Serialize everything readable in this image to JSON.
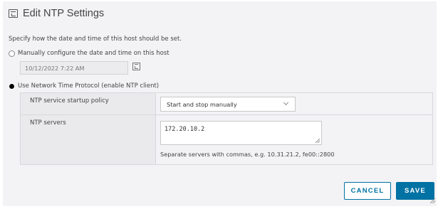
{
  "dialog": {
    "title": "Edit NTP Settings",
    "description": "Specify how the date and time of this host should be set."
  },
  "options": {
    "manual_label": "Manually configure the date and time on this host",
    "manual_datetime": "10/12/2022 7:22 AM",
    "ntp_label": "Use Network Time Protocol (enable NTP client)",
    "selected": "ntp"
  },
  "ntp": {
    "policy_label": "NTP service startup policy",
    "policy_value": "Start and stop manually",
    "servers_label": "NTP servers",
    "servers_value": "172.20.10.2",
    "servers_hint": "Separate servers with commas, e.g. 10.31.21.2, fe00::2800"
  },
  "buttons": {
    "cancel": "CANCEL",
    "save": "SAVE"
  },
  "colors": {
    "accent": "#0072a3",
    "background": "#f3f3f5"
  },
  "icons": {
    "title": "edit-settings-icon",
    "calendar": "calendar-icon",
    "dropdown": "chevron-down-icon"
  }
}
